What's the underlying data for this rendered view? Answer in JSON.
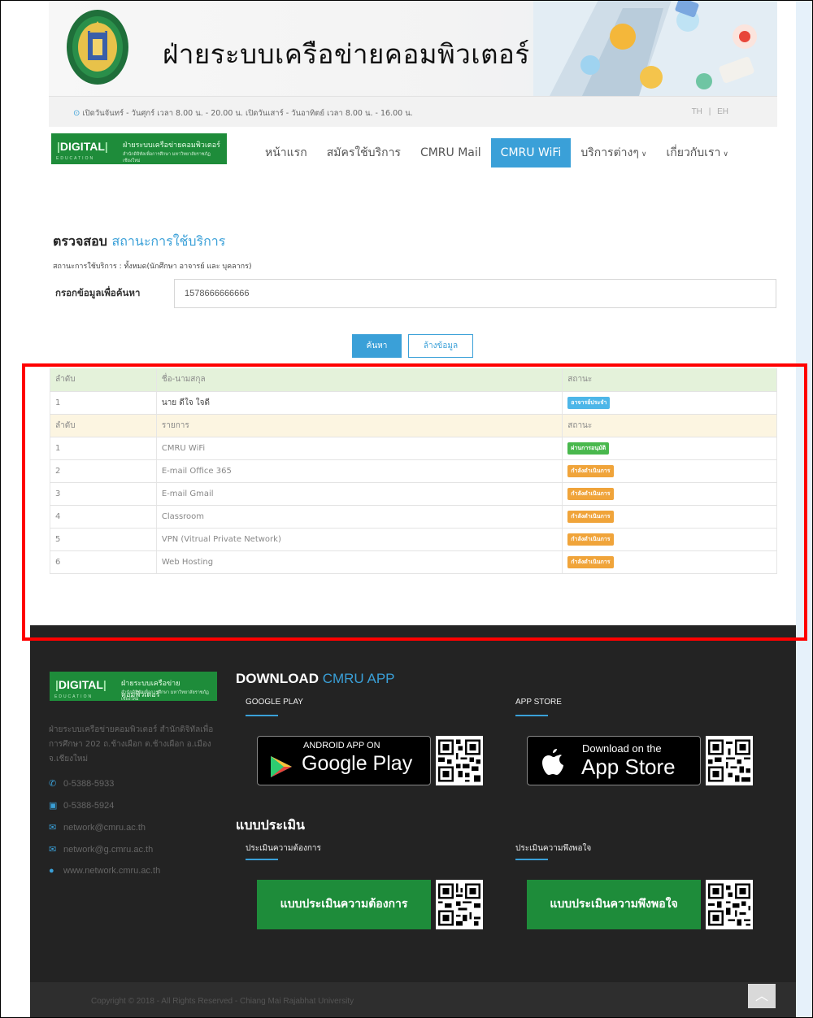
{
  "header": {
    "title": "ฝ่ายระบบเครือข่ายคอมพิวเตอร์",
    "hours": "เปิดวันจันทร์ - วันศุกร์ เวลา 8.00 น. - 20.00 น. เปิดวันเสาร์ - วันอาทิตย์ เวลา 8.00 น. - 16.00 น.",
    "lang_th": "TH",
    "lang_sep": "|",
    "lang_en": "EH"
  },
  "brand": {
    "main": "DIGITAL",
    "sub": "EDUCATION",
    "th_line1": "ฝ่ายระบบเครือข่ายคอมพิวเตอร์",
    "th_line2": "สำนักดิจิทัลเพื่อการศึกษา มหาวิทยาลัยราชภัฏเชียงใหม่"
  },
  "nav": {
    "items": [
      {
        "label": "หน้าแรก"
      },
      {
        "label": "สมัครใช้บริการ"
      },
      {
        "label": "CMRU Mail"
      },
      {
        "label": "CMRU WiFi",
        "active": true
      },
      {
        "label": "บริการต่างๆ",
        "has_dropdown": true
      },
      {
        "label": "เกี่ยวกับเรา",
        "has_dropdown": true
      }
    ]
  },
  "search": {
    "title_bold": "ตรวจสอบ",
    "title_accent": "สถานะการใช้บริการ",
    "subtitle": "สถานะการใช้บริการ : ทั้งหมด(นักศึกษา อาจารย์ และ บุคลากร)",
    "label": "กรอกข้อมูลเพื่อค้นหา",
    "value": "1578666666666",
    "search_button": "ค้นหา",
    "clear_button": "ล้างข้อมูล"
  },
  "user_table": {
    "headers": [
      "ลำดับ",
      "ชื่อ-นามสกุล",
      "สถานะ"
    ],
    "row": {
      "no": "1",
      "name": "นาย ดีใจ ใจดี",
      "status": "อาจารย์ประจำ"
    }
  },
  "service_table": {
    "headers": [
      "ลำดับ",
      "รายการ",
      "สถานะ"
    ],
    "rows": [
      {
        "no": "1",
        "name": "CMRU WiFi",
        "status": "ผ่านการอนุมัติ",
        "color": "#49b84d"
      },
      {
        "no": "2",
        "name": "E-mail Office 365",
        "status": "กำลังดำเนินการ",
        "color": "#f0a43a"
      },
      {
        "no": "3",
        "name": "E-mail Gmail",
        "status": "กำลังดำเนินการ",
        "color": "#f0a43a"
      },
      {
        "no": "4",
        "name": "Classroom",
        "status": "กำลังดำเนินการ",
        "color": "#f0a43a"
      },
      {
        "no": "5",
        "name": "VPN (Vitrual Private Network)",
        "status": "กำลังดำเนินการ",
        "color": "#f0a43a"
      },
      {
        "no": "6",
        "name": "Web Hosting",
        "status": "กำลังดำเนินการ",
        "color": "#f0a43a"
      }
    ]
  },
  "footer": {
    "address": "ฝ่ายระบบเครือข่ายคอมพิวเตอร์ สำนักดิจิทัลเพื่อการศึกษา 202 ถ.ช้างเผือก ต.ช้างเผือก อ.เมือง จ.เชียงใหม่",
    "phone": "0-5388-5933",
    "fax": "0-5388-5924",
    "email1": "network@cmru.ac.th",
    "email2": "network@g.cmru.ac.th",
    "website": "www.network.cmru.ac.th",
    "download_bold": "DOWNLOAD",
    "download_accent": "CMRU APP",
    "google_play_head": "GOOGLE PLAY",
    "app_store_head": "APP STORE",
    "google_top": "ANDROID APP ON",
    "google_main": "Google Play",
    "apple_top": "Download on the",
    "apple_main": "App Store",
    "eval_title": "แบบประเมิน",
    "eval_need_head": "ประเมินความต้องการ",
    "eval_sat_head": "ประเมินความพึงพอใจ",
    "eval_need_button": "แบบประเมินความต้องการ",
    "eval_sat_button": "แบบประเมินความพึงพอใจ",
    "copyright": "Copyright © 2018 - All Rights Reserved - Chiang Mai Rajabhat University"
  },
  "colors": {
    "accent": "#3aa0d8",
    "brand_green": "#1e8c3a",
    "highlight_red": "#ff0000",
    "badge_blue": "#4db6e8",
    "badge_green": "#49b84d",
    "badge_orange": "#f0a43a"
  }
}
